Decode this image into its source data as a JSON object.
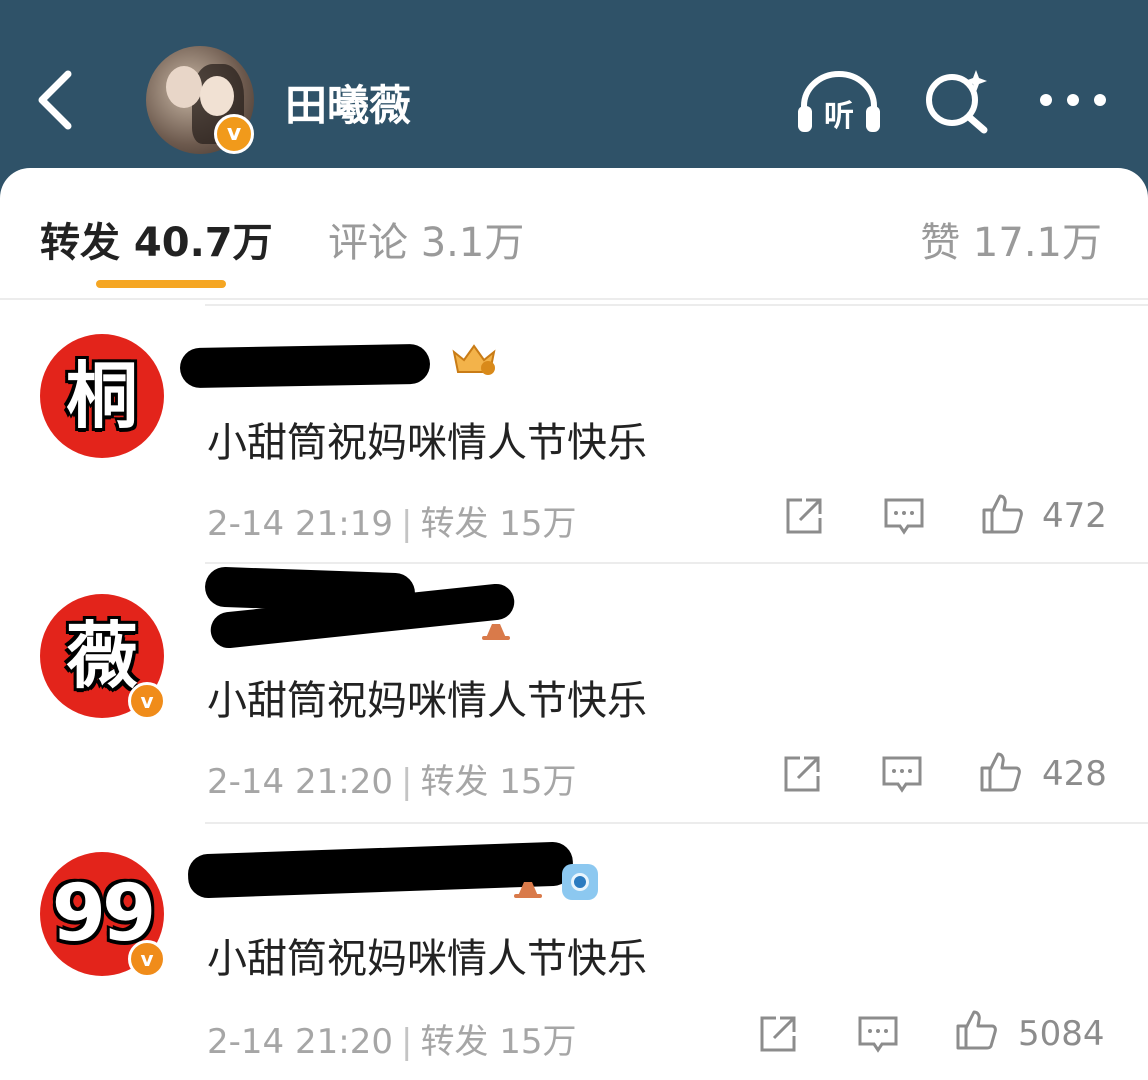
{
  "header": {
    "title": "田曦薇",
    "verified_badge": "v",
    "back_icon": "chevron-left-icon",
    "listen_label": "听",
    "icons": [
      "headphones-icon",
      "search-sparkle-icon",
      "more-dots-icon"
    ],
    "background": "#2f5268"
  },
  "tabs": {
    "repost": "转发 40.7万",
    "comment": "评论 3.1万",
    "like": "赞 17.1万",
    "active_color": "#f5a623"
  },
  "items": [
    {
      "avatar_text": "桐",
      "verified": false,
      "content": "小甜筒祝妈咪情人节快乐",
      "time": "2-14 21:19",
      "repost_label": "转发 15万",
      "likes": "472"
    },
    {
      "avatar_text": "薇",
      "verified": true,
      "content": "小甜筒祝妈咪情人节快乐",
      "time": "2-14 21:20",
      "repost_label": "转发 15万",
      "likes": "428"
    },
    {
      "avatar_text": "99",
      "verified": true,
      "content": "小甜筒祝妈咪情人节快乐",
      "time": "2-14 21:20",
      "repost_label": "转发 15万",
      "likes": "5084"
    }
  ],
  "colors": {
    "avatar_red": "#e3241b",
    "verified_orange": "#f08c1a"
  }
}
